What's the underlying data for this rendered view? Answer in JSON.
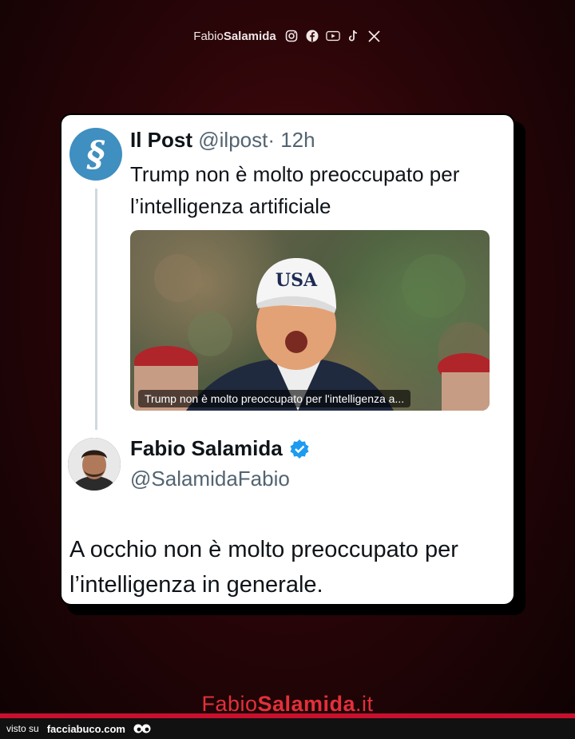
{
  "header": {
    "brand_first": "Fabio",
    "brand_bold": "Salamida",
    "icons": [
      "instagram-icon",
      "facebook-icon",
      "youtube-icon",
      "tiktok-icon",
      "x-icon"
    ]
  },
  "quoted_tweet": {
    "avatar_letter": "§",
    "name": "Il Post",
    "handle": "@ilpost",
    "time": "· 12h",
    "text": "Trump non è molto preoccupato per l’intelligenza artificiale",
    "media_caption": "Trump non è molto preoccupato per l'intelligenza a...",
    "hat_text": "USA"
  },
  "reply_tweet": {
    "name": "Fabio Salamida",
    "handle": "@SalamidaFabio",
    "text": "A occhio non è molto preoccupato per l’intelligenza in generale."
  },
  "footer": {
    "brand_first": "Fabio",
    "brand_bold": "Salamida",
    "brand_tld": ".it",
    "visto_su": "visto su",
    "site": "facciabuco.com"
  },
  "colors": {
    "accent_red": "#e3303a",
    "verified_blue": "#1d9bf0",
    "ilpost_blue": "#3f8fc0"
  }
}
